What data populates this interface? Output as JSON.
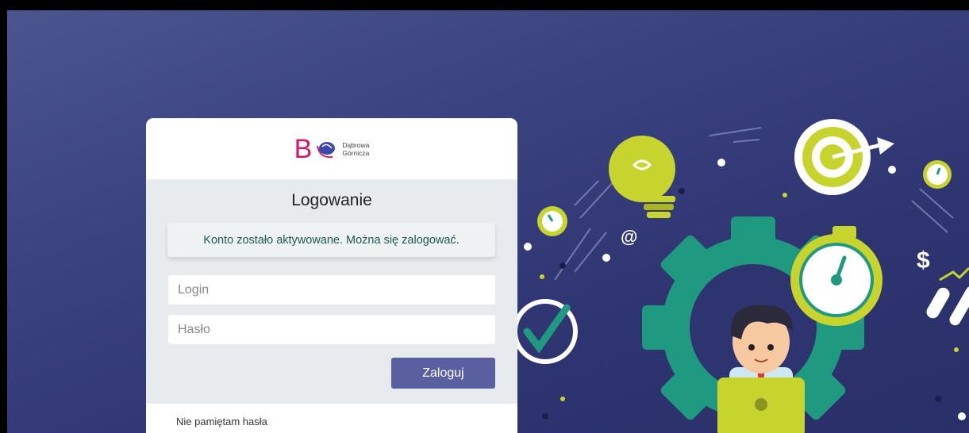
{
  "brand": {
    "letter": "B",
    "line1": "Dąbrowa",
    "line2": "Górnicza",
    "accent": "#d5176b"
  },
  "login": {
    "title": "Logowanie",
    "alert": "Konto zostało aktywowane. Można się zalogować.",
    "login_placeholder": "Login",
    "password_placeholder": "Hasło",
    "submit": "Zaloguj",
    "forgot": "Nie pamiętam hasła"
  },
  "illustration": {
    "at_symbol": "@",
    "dollar_symbol": "$"
  }
}
